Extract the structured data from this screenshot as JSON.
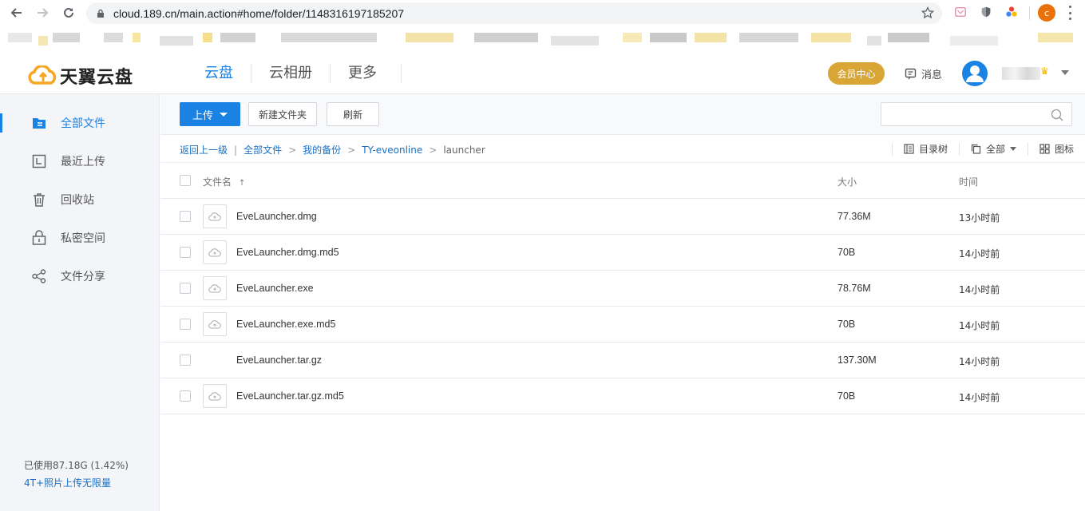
{
  "browser": {
    "url": "cloud.189.cn/main.action#home/folder/1148316197185207",
    "profile_initial": "c"
  },
  "header": {
    "logo_text": "天翼云盘",
    "nav": [
      "云盘",
      "云相册",
      "更多"
    ],
    "vip_label": "会员中心",
    "message_label": "消息"
  },
  "sidebar": {
    "items": [
      {
        "label": "全部文件",
        "icon": "folder-icon"
      },
      {
        "label": "最近上传",
        "icon": "recent-upload-icon"
      },
      {
        "label": "回收站",
        "icon": "trash-icon"
      },
      {
        "label": "私密空间",
        "icon": "lock-icon"
      },
      {
        "label": "文件分享",
        "icon": "share-icon"
      }
    ],
    "usage": "已使用87.18G (1.42%)",
    "upsell": "4T+照片上传无限量"
  },
  "toolbar": {
    "upload_label": "上传",
    "new_folder_label": "新建文件夹",
    "refresh_label": "刷新",
    "search_placeholder": ""
  },
  "breadcrumb": {
    "back": "返回上一级",
    "path": [
      "全部文件",
      "我的备份",
      "TY-eveonline"
    ],
    "current": "launcher"
  },
  "view_tools": {
    "tree": "目录树",
    "filter": "全部",
    "icon_view": "图标"
  },
  "list": {
    "headers": {
      "name": "文件名",
      "sort_arrow": "↑",
      "size": "大小",
      "time": "时间"
    },
    "rows": [
      {
        "name": "EveLauncher.dmg",
        "size": "77.36M",
        "time": "13小时前",
        "has_icon": true
      },
      {
        "name": "EveLauncher.dmg.md5",
        "size": "70B",
        "time": "14小时前",
        "has_icon": true
      },
      {
        "name": "EveLauncher.exe",
        "size": "78.76M",
        "time": "14小时前",
        "has_icon": true
      },
      {
        "name": "EveLauncher.exe.md5",
        "size": "70B",
        "time": "14小时前",
        "has_icon": true
      },
      {
        "name": "EveLauncher.tar.gz",
        "size": "137.30M",
        "time": "14小时前",
        "has_icon": false
      },
      {
        "name": "EveLauncher.tar.gz.md5",
        "size": "70B",
        "time": "14小时前",
        "has_icon": true
      }
    ]
  },
  "colors": {
    "accent": "#1a82e2",
    "vip": "#d9a534",
    "sidebar_bg": "#f3f5f8"
  }
}
